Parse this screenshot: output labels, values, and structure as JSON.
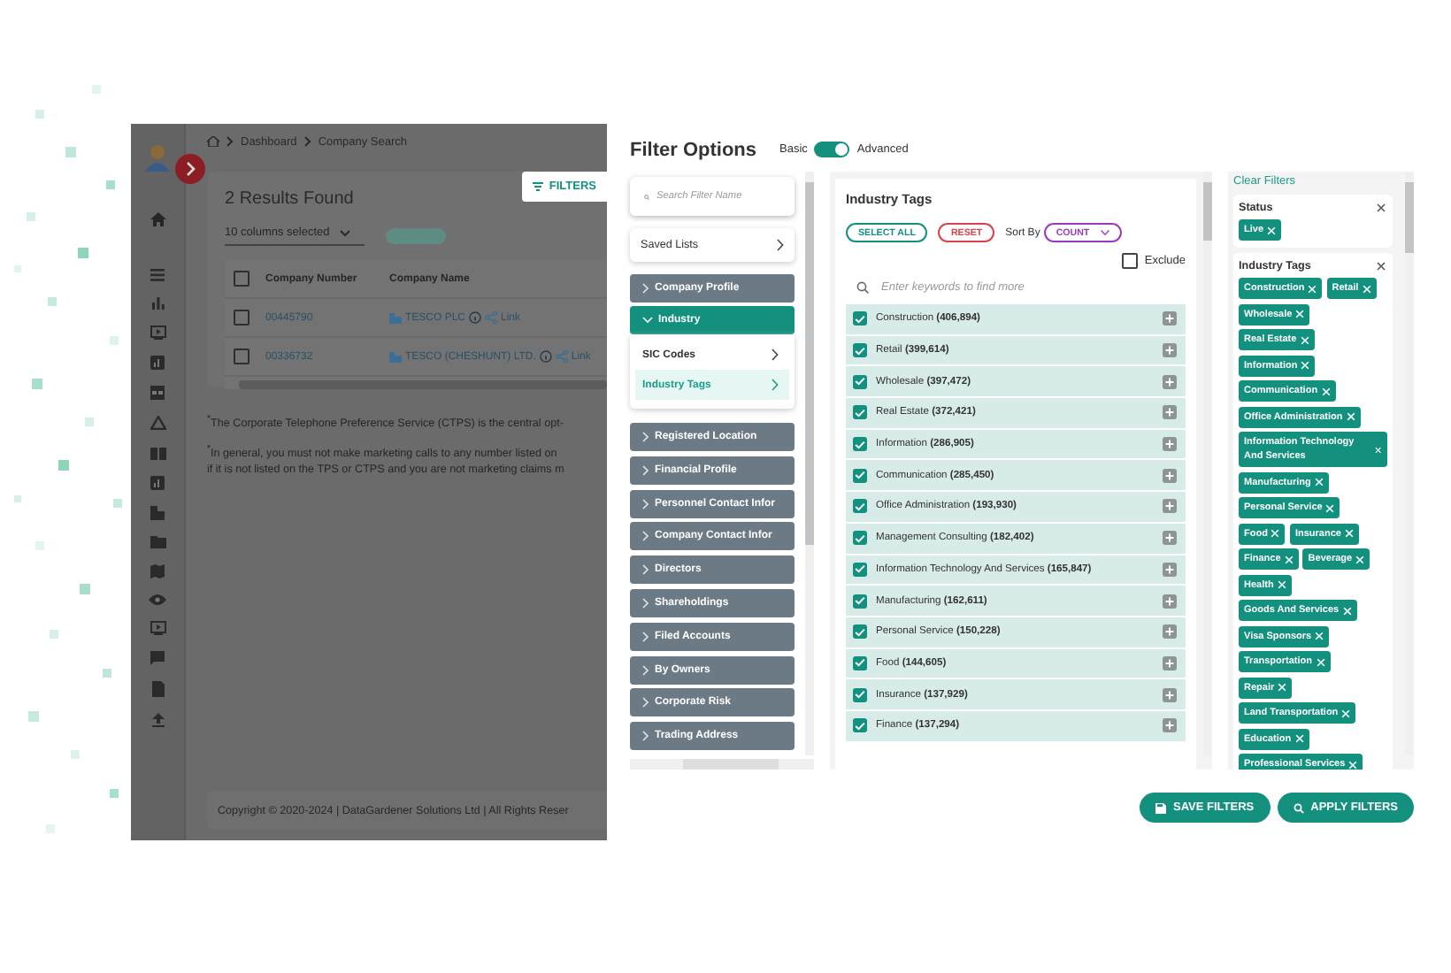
{
  "app": {
    "breadcrumb": [
      "Dashboard",
      "Company Search"
    ],
    "results_title": "2 Results Found",
    "columns_select": "10 columns selected",
    "filters_button": "FILTERS",
    "table": {
      "header_checked": false,
      "columns": [
        "Company Number",
        "Company Name"
      ],
      "rows": [
        {
          "number": "00445790",
          "name": "TESCO PLC",
          "link": "Link",
          "checked": false
        },
        {
          "number": "00336732",
          "name": "TESCO (CHESHUNT) LTD.",
          "link": "Link",
          "checked": false
        }
      ]
    },
    "notes": [
      "$^{*}$The Corporate Telephone Preference Service (CTPS) is the central opt-",
      "$^{*}$In general, you must not make marketing calls to any number listed on",
      "if it is not listed on the TPS or CTPS and you are not marketing claims m"
    ],
    "footer": "Copyright © 2020-2024 | DataGardener Solutions Ltd | All Rights Reser"
  },
  "filter_panel": {
    "title": "Filter Options",
    "mode": {
      "left_label": "Basic",
      "right_label": "Advanced",
      "on": true
    },
    "search": {
      "placeholder": "Search Filter Name"
    },
    "saved_lists": "Saved Lists",
    "categories": [
      {
        "label": "Company Profile",
        "expanded": false
      },
      {
        "label": "Industry",
        "expanded": true,
        "children": [
          {
            "label": "SIC Codes",
            "selected": false
          },
          {
            "label": "Industry Tags",
            "selected": true
          }
        ]
      },
      {
        "label": "Registered Location",
        "expanded": false
      },
      {
        "label": "Financial Profile",
        "expanded": false
      },
      {
        "label": "Personnel Contact Infor",
        "expanded": false
      },
      {
        "label": "Company Contact Infor",
        "expanded": false
      },
      {
        "label": "Directors",
        "expanded": false
      },
      {
        "label": "Shareholdings",
        "expanded": false
      },
      {
        "label": "Filed Accounts",
        "expanded": false
      },
      {
        "label": "By Owners",
        "expanded": false
      },
      {
        "label": "Corporate Risk",
        "expanded": false
      },
      {
        "label": "Trading Address",
        "expanded": false
      }
    ]
  },
  "tags_panel": {
    "title": "Industry Tags",
    "select_all": "SELECT ALL",
    "reset": "RESET",
    "sort_label": "Sort By",
    "sort_value": "COUNT",
    "exclude": {
      "label": "Exclude",
      "checked": false
    },
    "search": {
      "placeholder": "Enter keywords to find more"
    },
    "items": [
      {
        "name": "Construction",
        "count": "(406,894)",
        "checked": true
      },
      {
        "name": "Retail",
        "count": "(399,614)",
        "checked": true
      },
      {
        "name": "Wholesale",
        "count": "(397,472)",
        "checked": true
      },
      {
        "name": "Real Estate",
        "count": "(372,421)",
        "checked": true
      },
      {
        "name": "Information",
        "count": "(286,905)",
        "checked": true
      },
      {
        "name": "Communication",
        "count": "(285,450)",
        "checked": true
      },
      {
        "name": "Office Administration",
        "count": "(193,930)",
        "checked": true
      },
      {
        "name": "Management Consulting",
        "count": "(182,402)",
        "checked": true
      },
      {
        "name": "Information Technology And Services",
        "count": "(165,847)",
        "checked": true
      },
      {
        "name": "Manufacturing",
        "count": "(162,611)",
        "checked": true
      },
      {
        "name": "Personal Service",
        "count": "(150,228)",
        "checked": true
      },
      {
        "name": "Food",
        "count": "(144,605)",
        "checked": true
      },
      {
        "name": "Insurance",
        "count": "(137,929)",
        "checked": true
      },
      {
        "name": "Finance",
        "count": "(137,294)",
        "checked": true
      }
    ]
  },
  "applied": {
    "clear": "Clear Filters",
    "groups": [
      {
        "title": "Status",
        "tags": [
          "Live"
        ]
      },
      {
        "title": "Industry Tags",
        "tags": [
          "Construction",
          "Retail",
          "Wholesale",
          "Real Estate",
          "Information",
          "Communication",
          "Office Administration",
          "Information Technology And Services",
          "Manufacturing",
          "Personal Service",
          "Food",
          "Insurance",
          "Finance",
          "Beverage",
          "Health",
          "Goods And Services",
          "Visa Sponsors",
          "Transportation",
          "Repair",
          "Land Transportation",
          "Education",
          "Professional Services"
        ]
      }
    ]
  },
  "actions": [
    {
      "label": "SAVE FILTERS",
      "kind": "save"
    },
    {
      "label": "APPLY FILTERS",
      "kind": "apply"
    }
  ]
}
